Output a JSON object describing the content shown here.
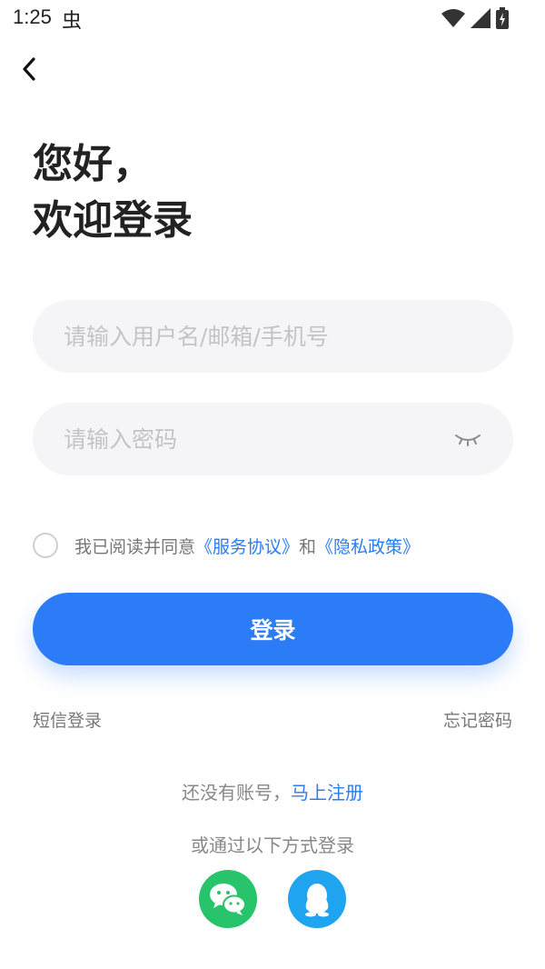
{
  "status_bar": {
    "time": "1:25",
    "bug_glyph": "虫"
  },
  "greeting": {
    "line1": "您好，",
    "line2": "欢迎登录"
  },
  "form": {
    "username_placeholder": "请输入用户名/邮箱/手机号",
    "password_placeholder": "请输入密码"
  },
  "agreement": {
    "prefix": "我已阅读并同意",
    "service_link": "《服务协议》",
    "and": "和",
    "privacy_link": "《隐私政策》"
  },
  "login_button": "登录",
  "sms_login": "短信登录",
  "forgot_password": "忘记密码",
  "register": {
    "prefix": "还没有账号，",
    "link": "马上注册"
  },
  "other_login_label": "或通过以下方式登录",
  "social": [
    {
      "name": "wechat-icon",
      "color": "#27c46b"
    },
    {
      "name": "qq-icon",
      "color": "#1fa4f0"
    }
  ],
  "colors": {
    "accent": "#2b7cf6",
    "input_bg": "#f5f5f7"
  }
}
